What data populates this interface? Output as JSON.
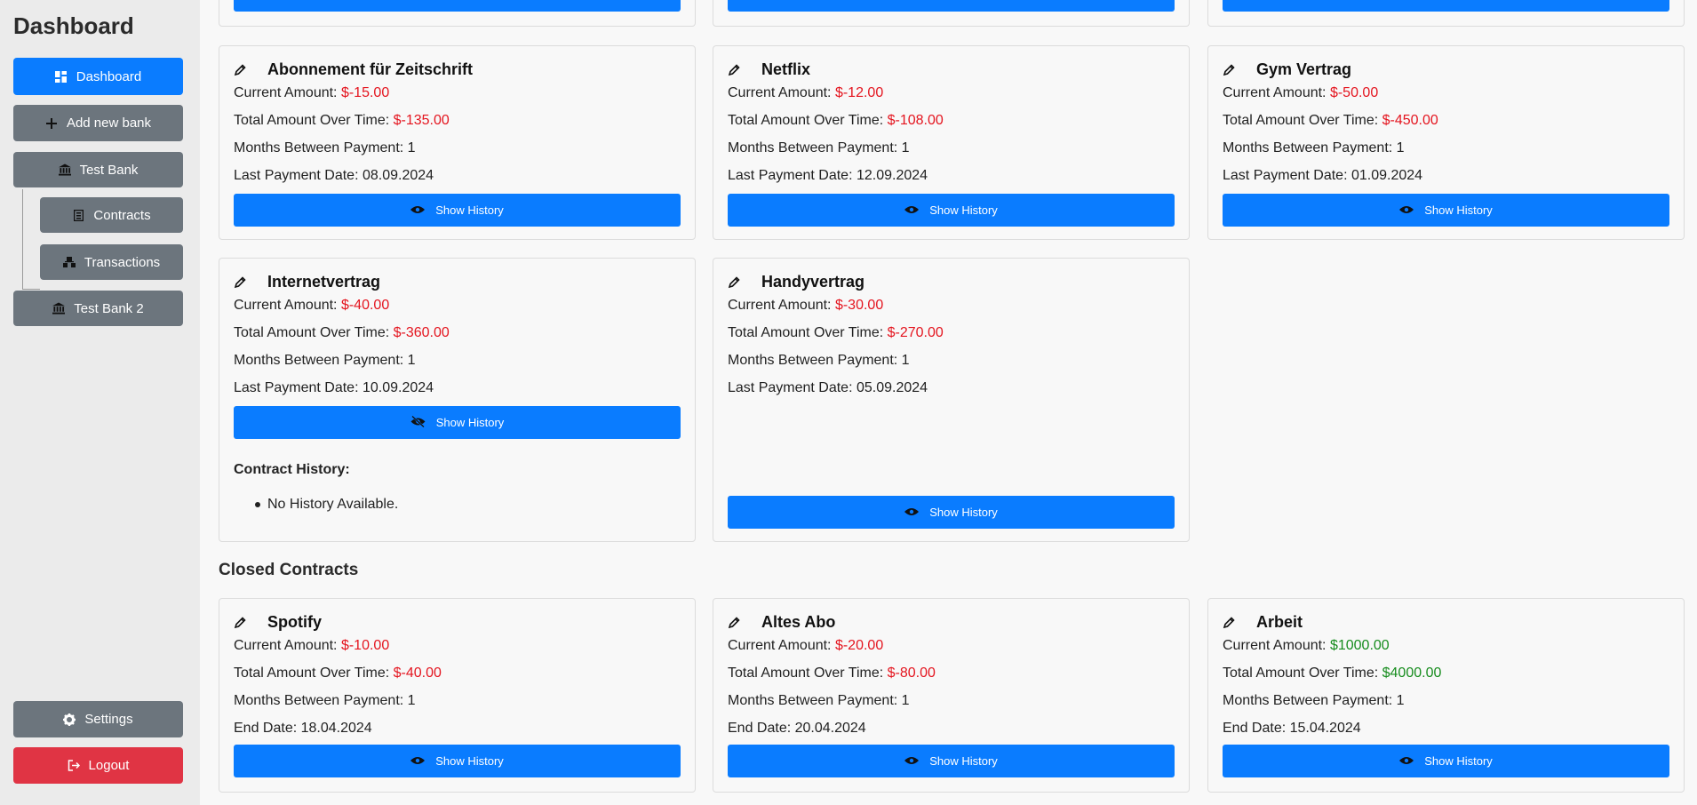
{
  "sidebar": {
    "title": "Dashboard",
    "items": [
      {
        "label": "Dashboard",
        "icon": "dashboard-icon"
      },
      {
        "label": "Add new bank",
        "icon": "plus-icon"
      },
      {
        "label": "Test Bank",
        "icon": "bank-icon"
      },
      {
        "label": "Contracts",
        "icon": "contract-icon"
      },
      {
        "label": "Transactions",
        "icon": "transactions-icon"
      },
      {
        "label": "Test Bank 2",
        "icon": "bank-icon"
      }
    ],
    "settings_label": "Settings",
    "logout_label": "Logout"
  },
  "labels": {
    "current_amount": "Current Amount: ",
    "total_amount": "Total Amount Over Time: ",
    "months_between": "Months Between Payment: ",
    "last_payment": "Last Payment Date: ",
    "end_date": "End Date: ",
    "show_history": "Show History",
    "contract_history": "Contract History:",
    "no_history": "No History Available."
  },
  "active_contracts": [
    {
      "name": "Abonnement für Zeitschrift",
      "current": "$-15.00",
      "total": "$-135.00",
      "months": "1",
      "last_date": "08.09.2024"
    },
    {
      "name": "Netflix",
      "current": "$-12.00",
      "total": "$-108.00",
      "months": "1",
      "last_date": "12.09.2024"
    },
    {
      "name": "Gym Vertrag",
      "current": "$-50.00",
      "total": "$-450.00",
      "months": "1",
      "last_date": "01.09.2024"
    },
    {
      "name": "Internetvertrag",
      "current": "$-40.00",
      "total": "$-360.00",
      "months": "1",
      "last_date": "10.09.2024"
    },
    {
      "name": "Handyvertrag",
      "current": "$-30.00",
      "total": "$-270.00",
      "months": "1",
      "last_date": "05.09.2024"
    }
  ],
  "closed_heading": "Closed Contracts",
  "closed_contracts": [
    {
      "name": "Spotify",
      "current": "$-10.00",
      "total": "$-40.00",
      "months": "1",
      "end_date": "18.04.2024"
    },
    {
      "name": "Altes Abo",
      "current": "$-20.00",
      "total": "$-80.00",
      "months": "1",
      "end_date": "20.04.2024"
    },
    {
      "name": "Arbeit",
      "current": "$1000.00",
      "total": "$4000.00",
      "months": "1",
      "end_date": "15.04.2024"
    }
  ],
  "colors": {
    "primary": "#0a7cff",
    "secondary": "#6c757d",
    "danger": "#e03444",
    "negative_amount": "#e4151f",
    "positive_amount": "#168c1d"
  }
}
